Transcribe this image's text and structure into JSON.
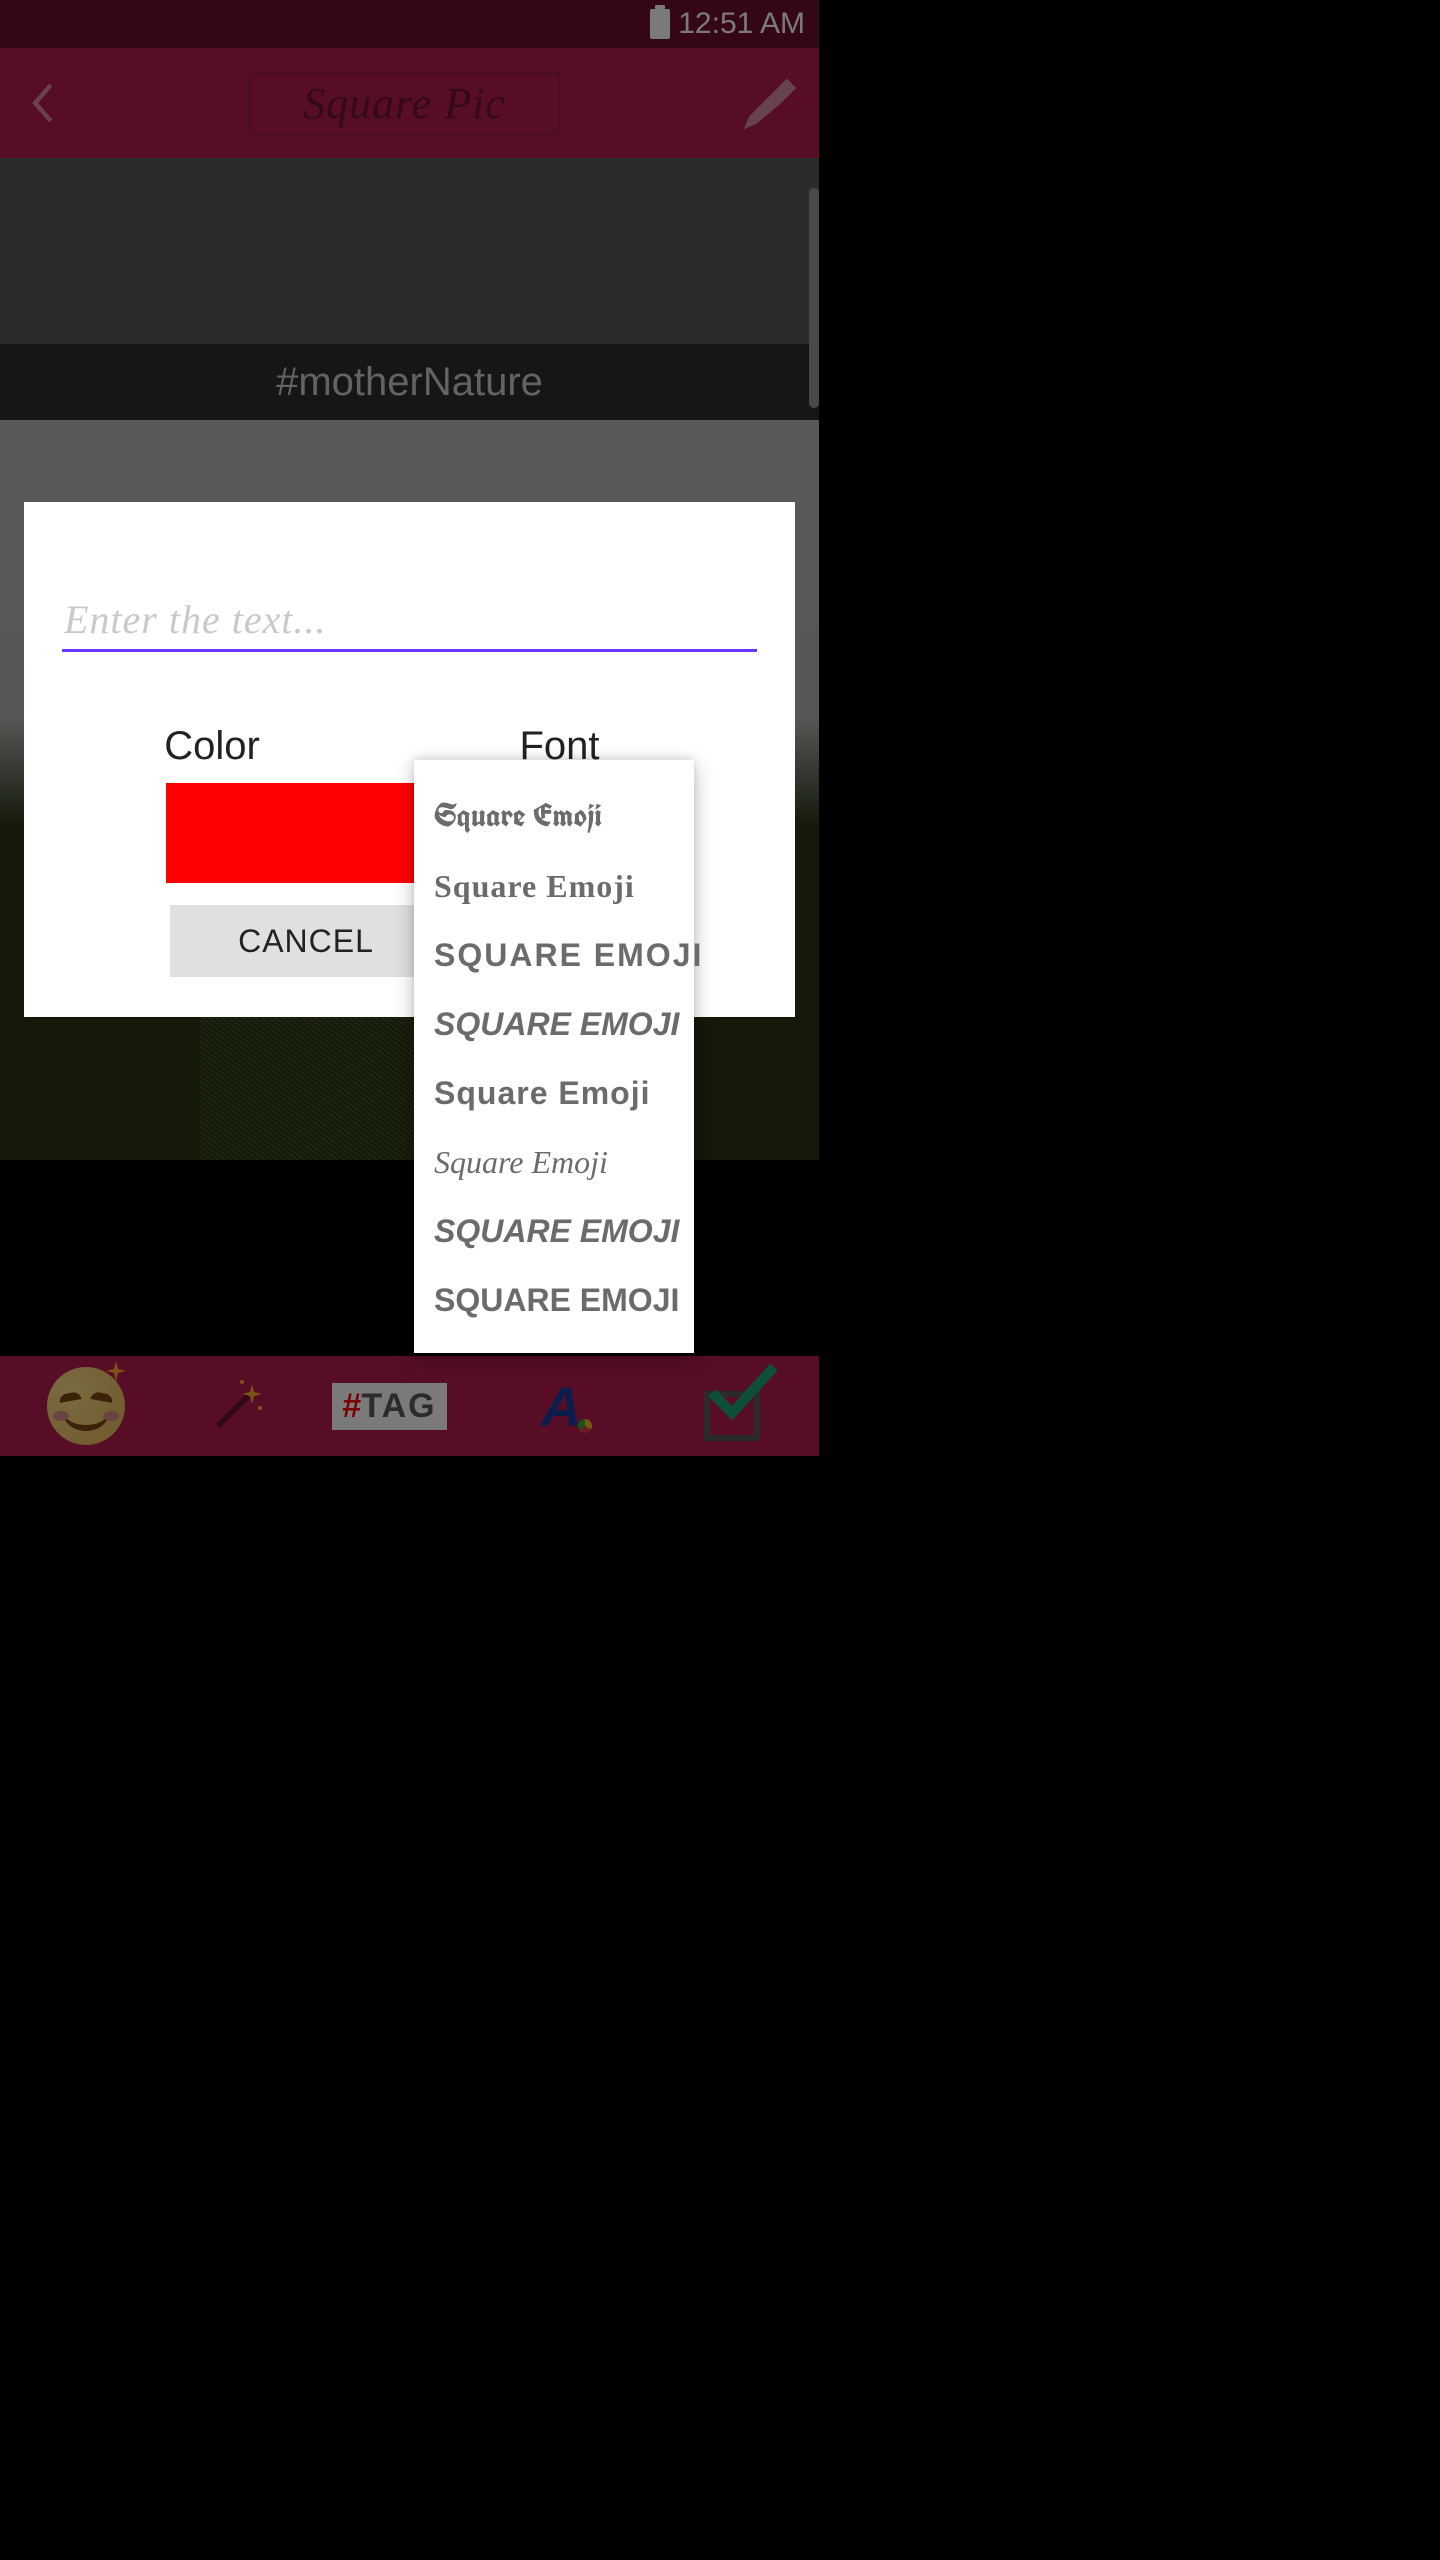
{
  "status": {
    "time": "12:51 AM"
  },
  "appbar": {
    "title": "Square Pic"
  },
  "canvas": {
    "hashtag": "#motherNature"
  },
  "dialog": {
    "input_placeholder": "Enter the text...",
    "input_value": "",
    "labels": {
      "color": "Color",
      "font": "Font"
    },
    "color_hex": "#ff0000",
    "cancel": "CANCEL"
  },
  "font_options": [
    "Square Emoji",
    "Square Emoji",
    "SQUARE EMOJI",
    "SQUARE EMOJI",
    "Square Emoji",
    "Square Emoji",
    "SQUARE EMOJI",
    "SQUARE EMOJI"
  ],
  "bottombar": {
    "tag_label_hash": "#",
    "tag_label_rest": "TAG",
    "font_label": "A"
  }
}
